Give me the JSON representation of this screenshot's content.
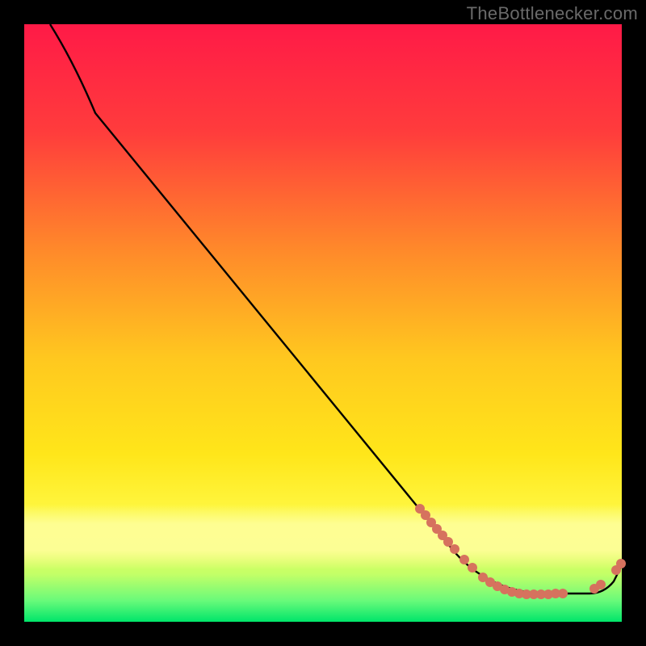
{
  "watermark": "TheBottlenecker.com",
  "annotation_text": "",
  "colors": {
    "dot": "#d6725e",
    "curve": "#000000",
    "gradient_top": "#ff1a47",
    "gradient_mid": "#ffe61a",
    "gradient_bottom": "#00e56a"
  },
  "chart_data": {
    "type": "line",
    "title": "",
    "xlabel": "",
    "ylabel": "",
    "xlim": [
      0,
      100
    ],
    "ylim": [
      0,
      100
    ],
    "grid": false,
    "legend": false,
    "notes": "No axis ticks or numeric labels are visible; x and y values below are relative 0–100 positions estimated from pixel geometry. The colored background encodes a red→yellow→green vertical gradient; the black curve descends from top-left, flattens into a valley near the bottom-right, then rises slightly at the far right. Coral dots mark samples along the lower portion of the curve.",
    "series": [
      {
        "name": "curve",
        "x": [
          4,
          12,
          72,
          82,
          90,
          95,
          99,
          100
        ],
        "y": [
          100,
          85,
          12,
          5,
          1,
          1,
          3,
          6
        ]
      },
      {
        "name": "dots",
        "x": [
          66,
          67,
          68,
          69,
          70,
          71,
          72,
          73.5,
          75,
          76.7,
          78,
          79.2,
          80.4,
          81.6,
          82.8,
          84,
          85.2,
          86.4,
          87.6,
          88.8,
          90,
          95.5,
          96.5,
          99,
          100
        ],
        "y": [
          19,
          18,
          16.8,
          15.7,
          14.6,
          13.5,
          12.3,
          10.6,
          9.3,
          7.7,
          6.9,
          6.2,
          5.6,
          5.3,
          5.0,
          4.9,
          4.9,
          4.9,
          4.9,
          5.0,
          5.0,
          5.8,
          6.5,
          8.9,
          10
        ]
      }
    ]
  }
}
